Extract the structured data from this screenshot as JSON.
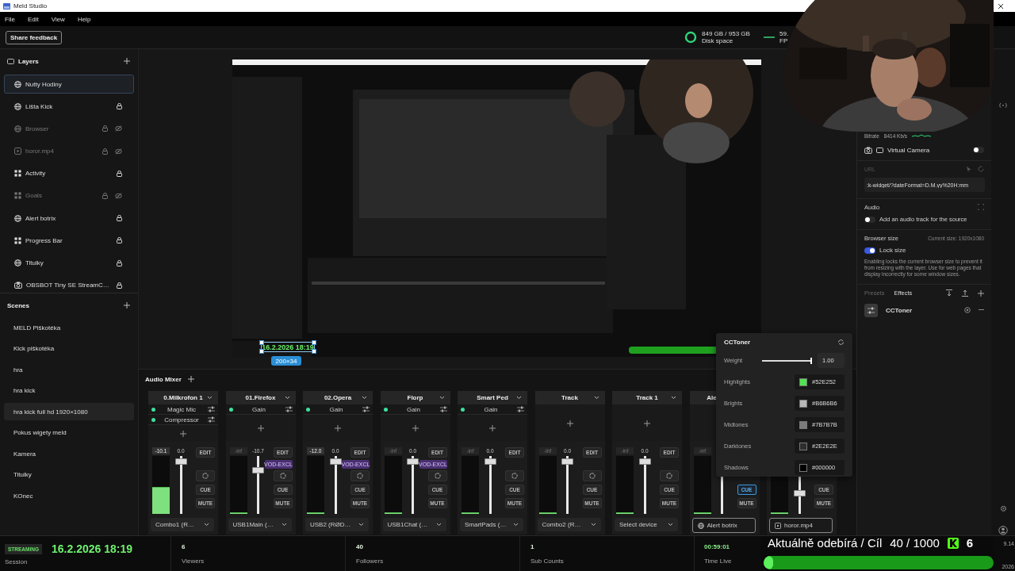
{
  "window": {
    "title": "Meld Studio"
  },
  "menu": [
    "File",
    "Edit",
    "View",
    "Help"
  ],
  "toolbar": {
    "feedback_button": "Share feedback",
    "disk": {
      "value": "849 GB / 953 GB",
      "label": "Disk space"
    },
    "fps": {
      "value": "59.",
      "label": "FP"
    }
  },
  "layers": {
    "title": "Layers",
    "items": [
      {
        "name": "Nutty Hodiny",
        "kind": "browser",
        "selected": true,
        "locked": false,
        "hidden": false
      },
      {
        "name": "Lišta Kick",
        "kind": "browser",
        "selected": false,
        "locked": true,
        "hidden": false
      },
      {
        "name": "Browser",
        "kind": "browser",
        "selected": false,
        "locked": true,
        "hidden": true
      },
      {
        "name": "horor.mp4",
        "kind": "video",
        "selected": false,
        "locked": true,
        "hidden": true
      },
      {
        "name": "Activity",
        "kind": "widget",
        "selected": false,
        "locked": true,
        "hidden": false
      },
      {
        "name": "Goals",
        "kind": "widget",
        "selected": false,
        "locked": true,
        "hidden": true
      },
      {
        "name": "Alert botrix",
        "kind": "browser",
        "selected": false,
        "locked": true,
        "hidden": false
      },
      {
        "name": "Progress Bar",
        "kind": "widget",
        "selected": false,
        "locked": true,
        "hidden": false
      },
      {
        "name": "Titulky",
        "kind": "browser",
        "selected": false,
        "locked": true,
        "hidden": false
      },
      {
        "name": "OBSBOT Tiny SE StreamC…",
        "kind": "camera",
        "selected": false,
        "locked": true,
        "hidden": false
      }
    ]
  },
  "scenes": {
    "title": "Scenes",
    "items": [
      {
        "name": "MELD Piškotéka",
        "selected": false
      },
      {
        "name": "Kick piškotéka",
        "selected": false
      },
      {
        "name": "hra",
        "selected": false
      },
      {
        "name": "hra kick",
        "selected": false
      },
      {
        "name": "hra kick full hd 1920×1080",
        "selected": true
      },
      {
        "name": "Pokus wigety meld",
        "selected": false
      },
      {
        "name": "Kamera",
        "selected": false
      },
      {
        "name": "Titulky",
        "selected": false
      },
      {
        "name": "KOnec",
        "selected": false
      }
    ]
  },
  "preview": {
    "selection": {
      "text": "16.2.2026 18:19",
      "size": "200×34"
    }
  },
  "audio_mixer": {
    "title": "Audio Mixer",
    "channels": [
      {
        "name": "0.Milkrofon 1",
        "effects": [
          {
            "label": "Magic Mic",
            "on": true
          },
          {
            "label": "Compressor",
            "on": true
          }
        ],
        "meter": {
          "reading": "-10.1",
          "level": 0.45
        },
        "fader": {
          "reading": "0.0",
          "level": 0.9
        },
        "buttons": [
          {
            "kind": "edit",
            "label": "EDIT"
          },
          {
            "kind": "loop"
          },
          {
            "kind": "cue",
            "label": "CUE",
            "on": false
          },
          {
            "kind": "mute",
            "label": "MUTE",
            "on": false
          }
        ],
        "device": {
          "kind": "select",
          "label": "Combo1 (R…"
        }
      },
      {
        "name": "01.Firefox",
        "effects": [
          {
            "label": "Gain",
            "on": true
          }
        ],
        "meter": {
          "reading": "-inf",
          "level": 0.02
        },
        "fader": {
          "reading": "-10.7",
          "level": 0.75
        },
        "buttons": [
          {
            "kind": "edit",
            "label": "EDIT"
          },
          {
            "kind": "badge",
            "label": "VOD-EXCL"
          },
          {
            "kind": "loop"
          },
          {
            "kind": "cue",
            "label": "CUE",
            "on": false
          },
          {
            "kind": "mute",
            "label": "MUTE",
            "on": false
          }
        ],
        "device": {
          "kind": "select",
          "label": "USB1Main (…"
        }
      },
      {
        "name": "02.Opera",
        "effects": [
          {
            "label": "Gain",
            "on": true
          }
        ],
        "meter": {
          "reading": "-12.0",
          "level": 0.02
        },
        "fader": {
          "reading": "0.0",
          "level": 0.9
        },
        "buttons": [
          {
            "kind": "edit",
            "label": "EDIT"
          },
          {
            "kind": "badge",
            "label": "VOD-EXCL"
          },
          {
            "kind": "loop"
          },
          {
            "kind": "cue",
            "label": "CUE",
            "on": false
          },
          {
            "kind": "mute",
            "label": "MUTE",
            "on": false
          }
        ],
        "device": {
          "kind": "select",
          "label": "USB2 (RØD…"
        }
      },
      {
        "name": "Florp",
        "effects": [
          {
            "label": "Gain",
            "on": true
          }
        ],
        "meter": {
          "reading": "-inf",
          "level": 0.02
        },
        "fader": {
          "reading": "0.0",
          "level": 0.9
        },
        "buttons": [
          {
            "kind": "edit",
            "label": "EDIT"
          },
          {
            "kind": "badge",
            "label": "VOD-EXCL"
          },
          {
            "kind": "loop"
          },
          {
            "kind": "cue",
            "label": "CUE",
            "on": false
          },
          {
            "kind": "mute",
            "label": "MUTE",
            "on": false
          }
        ],
        "device": {
          "kind": "select",
          "label": "USB1Chat (…"
        }
      },
      {
        "name": "Smart Ped",
        "effects": [
          {
            "label": "Gain",
            "on": true
          }
        ],
        "meter": {
          "reading": "-inf",
          "level": 0.02
        },
        "fader": {
          "reading": "0.0",
          "level": 0.9
        },
        "buttons": [
          {
            "kind": "edit",
            "label": "EDIT"
          },
          {
            "kind": "loop"
          },
          {
            "kind": "cue",
            "label": "CUE",
            "on": false
          },
          {
            "kind": "mute",
            "label": "MUTE",
            "on": false
          }
        ],
        "device": {
          "kind": "select",
          "label": "SmartPads (…"
        }
      },
      {
        "name": "Track",
        "meter": {
          "reading": "-inf",
          "level": 0.02
        },
        "fader": {
          "reading": "0.0",
          "level": 0.9
        },
        "buttons": [
          {
            "kind": "edit",
            "label": "EDIT"
          },
          {
            "kind": "loop"
          },
          {
            "kind": "cue",
            "label": "CUE",
            "on": false
          },
          {
            "kind": "mute",
            "label": "MUTE",
            "on": false
          }
        ],
        "device": {
          "kind": "select",
          "label": "Combo2 (R…"
        }
      },
      {
        "name": "Track 1",
        "meter": {
          "reading": "-inf",
          "level": 0.02
        },
        "fader": {
          "reading": "0.0",
          "level": 0.9
        },
        "buttons": [
          {
            "kind": "edit",
            "label": "EDIT"
          },
          {
            "kind": "loop"
          },
          {
            "kind": "cue",
            "label": "CUE",
            "on": false
          },
          {
            "kind": "mute",
            "label": "MUTE",
            "on": false
          }
        ],
        "device": {
          "kind": "select",
          "label": "Select device"
        }
      },
      {
        "name": "Ale",
        "meter": {
          "reading": "-inf",
          "level": 0.02
        },
        "buttons": [
          {
            "kind": "cue",
            "label": "CUE",
            "on": true
          },
          {
            "kind": "mute",
            "label": "MUTE",
            "on": false
          }
        ],
        "device": {
          "kind": "browser",
          "label": "Alert botrix"
        }
      },
      {
        "meter": {
          "level": 0.02
        },
        "fader": {
          "level": 0.35
        },
        "buttons": [
          {
            "kind": "cue",
            "label": "CUE",
            "on": false
          },
          {
            "kind": "mute",
            "label": "MUTE",
            "on": false
          }
        ],
        "device": {
          "kind": "video",
          "label": "horor.mp4"
        }
      }
    ]
  },
  "cctoner": {
    "title": "CCToner",
    "weight": {
      "label": "Weight",
      "level": 1,
      "value": "1.00"
    },
    "colors": [
      {
        "label": "Highlights",
        "value": "#52E252",
        "color": "#52e252"
      },
      {
        "label": "Brights",
        "value": "#B6B6B6",
        "color": "#b6b6b6"
      },
      {
        "label": "Midtones",
        "value": "#7B7B7B",
        "color": "#7b7b7b"
      },
      {
        "label": "Darktones",
        "value": "#2E2E2E",
        "color": "#2e2e2e"
      },
      {
        "label": "Shadows",
        "value": "#000000",
        "color": "#000000"
      }
    ]
  },
  "right_panel": {
    "bitrate": {
      "label": "Bitrate",
      "value": "8414 Kb/s"
    },
    "virtual_camera": {
      "label": "Virtual Camera",
      "on": false
    },
    "url": {
      "label": "URL",
      "value": ":k-widget/?dateFormat=D.M.yy%20H:mm"
    },
    "audio": {
      "title": "Audio",
      "track_label": "Add an audio track for the source",
      "on": false
    },
    "browser_size": {
      "title": "Browser size",
      "current": "Current size: 1920x1080",
      "lock_label": "Lock size",
      "lock_on": true,
      "description": "Enabling locks the current browser size to prevent it from resizing with the layer. Use for web pages that display incorrectly for some window sizes."
    },
    "tabs": [
      {
        "label": "Presets",
        "selected": false
      },
      {
        "label": "Effects",
        "selected": true
      }
    ],
    "effects": [
      {
        "name": "CCToner"
      }
    ]
  },
  "status_bar": {
    "badge": "STREAMING",
    "date": "16.2.2026 18:19",
    "session": "Session",
    "stats": [
      {
        "kind": "count",
        "value": "6",
        "label": "Viewers"
      },
      {
        "kind": "count",
        "value": "40",
        "label": "Followers"
      },
      {
        "kind": "count",
        "value": "1",
        "label": "Sub Counts"
      },
      {
        "kind": "time",
        "value": "00:59:01",
        "label": "Time Live"
      }
    ]
  },
  "goal_overlay": {
    "label": "Aktuálně odebírá / Cíl",
    "progress": "40 / 1000",
    "count": "6",
    "level": 0.04
  },
  "taskbar_clock": {
    "time": "9.14",
    "date": "2026"
  }
}
